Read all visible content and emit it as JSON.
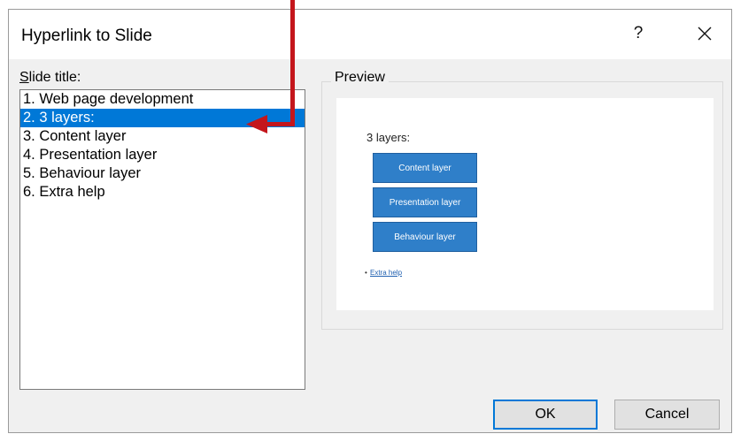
{
  "dialog": {
    "title": "Hyperlink to Slide",
    "help_label": "?"
  },
  "slide_list": {
    "label_accel": "S",
    "label_rest": "lide title:",
    "items": [
      {
        "label": "1. Web page development",
        "selected": false
      },
      {
        "label": "2. 3 layers:",
        "selected": true
      },
      {
        "label": "3. Content layer",
        "selected": false
      },
      {
        "label": "4. Presentation layer",
        "selected": false
      },
      {
        "label": "5. Behaviour layer",
        "selected": false
      },
      {
        "label": "6. Extra help",
        "selected": false
      }
    ]
  },
  "preview": {
    "label": "Preview",
    "heading": "3 layers:",
    "boxes": [
      "Content layer",
      "Presentation layer",
      "Behaviour layer"
    ],
    "bullet": "•",
    "link": "Extra help",
    "box_color": "#2f7fc9"
  },
  "buttons": {
    "ok": "OK",
    "cancel": "Cancel"
  },
  "colors": {
    "selection": "#0078d7",
    "annotation_arrow": "#c4161c"
  }
}
